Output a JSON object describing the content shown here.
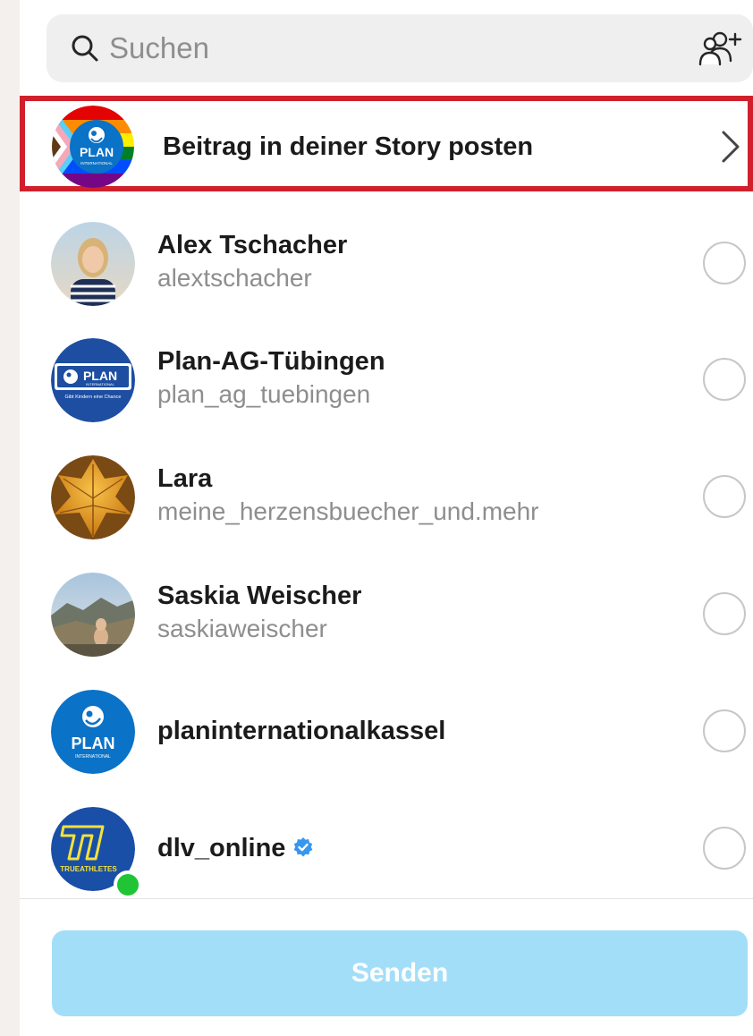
{
  "search": {
    "placeholder": "Suchen",
    "icon": "search-icon",
    "add_icon": "add-people-icon"
  },
  "story": {
    "label": "Beitrag in deiner Story posten",
    "avatar_text": "PLAN",
    "avatar_subtext": "INTERNATIONAL"
  },
  "contacts": [
    {
      "name": "Alex Tschacher",
      "username": "alextschacher"
    },
    {
      "name": "Plan-AG-Tübingen",
      "username": "plan_ag_tuebingen",
      "avatar_text": "PLAN",
      "avatar_subtext": "INTERNATIONAL",
      "avatar_caption": "Gibt Kindern eine Chance"
    },
    {
      "name": "Lara",
      "username": "meine_herzensbuecher_und.mehr"
    },
    {
      "name": "Saskia Weischer",
      "username": "saskiaweischer"
    },
    {
      "name": "planinternationalkassel",
      "username": "",
      "avatar_text": "PLAN",
      "avatar_subtext": "INTERNATIONAL"
    },
    {
      "name": "dlv_online",
      "username": "",
      "verified": true,
      "online": true,
      "avatar_text": "TRUEATHLETES"
    }
  ],
  "footer": {
    "send_label": "Senden"
  },
  "colors": {
    "highlight_border": "#d0202c",
    "send_button": "#a3def9",
    "verified": "#3797f0",
    "online": "#1fc534"
  }
}
